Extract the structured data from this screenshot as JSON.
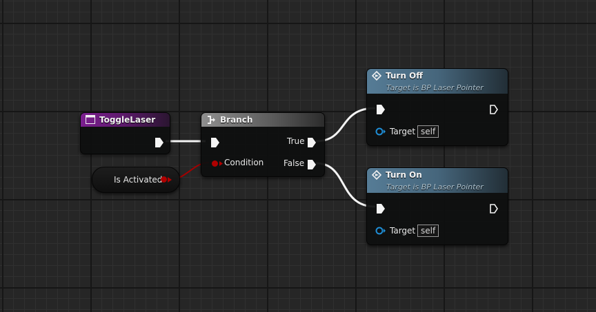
{
  "graph": {
    "event_node": {
      "title": "ToggleLaser",
      "color": "#7b1f8f"
    },
    "branch_node": {
      "title": "Branch",
      "condition_label": "Condition",
      "true_label": "True",
      "false_label": "False"
    },
    "variable_node": {
      "label": "Is Activated",
      "color": "#8b0000"
    },
    "turn_off_node": {
      "title": "Turn Off",
      "subtitle": "Target is BP Laser Pointer",
      "target_label": "Target",
      "target_value": "self"
    },
    "turn_on_node": {
      "title": "Turn On",
      "subtitle": "Target is BP Laser Pointer",
      "target_label": "Target",
      "target_value": "self"
    }
  },
  "icons": {
    "event": "event-node-icon",
    "branch": "branch-node-icon",
    "function": "function-call-icon",
    "exec_pin": "exec-pin-icon",
    "data_pin": "data-pin-icon",
    "object_pin": "object-reference-pin-icon"
  },
  "colors": {
    "canvas": "#262626",
    "exec_wire": "#ffffff",
    "bool_wire": "#a50000",
    "object_pin": "#1f8fd8"
  }
}
